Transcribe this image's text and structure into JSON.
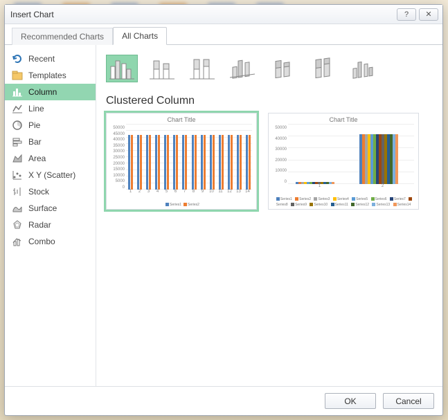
{
  "window": {
    "title": "Insert Chart",
    "help_glyph": "?",
    "close_glyph": "✕"
  },
  "tabs": {
    "recommended": "Recommended Charts",
    "all": "All Charts",
    "active": "all"
  },
  "sidebar": {
    "items": [
      {
        "id": "recent",
        "label": "Recent"
      },
      {
        "id": "templates",
        "label": "Templates"
      },
      {
        "id": "column",
        "label": "Column"
      },
      {
        "id": "line",
        "label": "Line"
      },
      {
        "id": "pie",
        "label": "Pie"
      },
      {
        "id": "bar",
        "label": "Bar"
      },
      {
        "id": "area",
        "label": "Area"
      },
      {
        "id": "xy",
        "label": "X Y (Scatter)"
      },
      {
        "id": "stock",
        "label": "Stock"
      },
      {
        "id": "surface",
        "label": "Surface"
      },
      {
        "id": "radar",
        "label": "Radar"
      },
      {
        "id": "combo",
        "label": "Combo"
      }
    ],
    "selected": "column"
  },
  "section": {
    "title": "Clustered Column"
  },
  "subtypes": {
    "selected": 0,
    "count": 7
  },
  "previews": {
    "p1": {
      "title": "Chart Title",
      "legend": [
        "Series1",
        "Series2"
      ]
    },
    "p2": {
      "title": "Chart Title",
      "legend": [
        "Series1",
        "Series2",
        "Series3",
        "Series4",
        "Series5",
        "Series6",
        "Series7",
        "Series8",
        "Series9",
        "Series10",
        "Series11",
        "Series12",
        "Series13",
        "Series14"
      ]
    }
  },
  "buttons": {
    "ok": "OK",
    "cancel": "Cancel"
  },
  "chart_data": [
    {
      "type": "bar",
      "title": "Chart Title",
      "categories": [
        "1",
        "2",
        "3",
        "4",
        "5",
        "6",
        "7",
        "8",
        "9",
        "10",
        "11",
        "12",
        "13",
        "14"
      ],
      "series": [
        {
          "name": "Series1",
          "values": [
            42000,
            42000,
            42000,
            42000,
            42000,
            42000,
            42000,
            42000,
            42000,
            42000,
            42000,
            42000,
            42000,
            42000
          ]
        },
        {
          "name": "Series2",
          "values": [
            42000,
            42000,
            42000,
            42000,
            42000,
            42000,
            42000,
            42000,
            42000,
            42000,
            42000,
            42000,
            42000,
            42000
          ]
        }
      ],
      "ylim": [
        0,
        50000
      ],
      "yticks": [
        0,
        5000,
        10000,
        15000,
        20000,
        25000,
        30000,
        35000,
        40000,
        45000,
        50000
      ],
      "colors": [
        "#4e81bd",
        "#ed7d31"
      ]
    },
    {
      "type": "bar",
      "title": "Chart Title",
      "categories": [
        "1",
        "2"
      ],
      "series": [
        {
          "name": "Series1",
          "values": [
            1500,
            42000
          ]
        },
        {
          "name": "Series2",
          "values": [
            1500,
            42000
          ]
        },
        {
          "name": "Series3",
          "values": [
            1500,
            42000
          ]
        },
        {
          "name": "Series4",
          "values": [
            1500,
            42000
          ]
        },
        {
          "name": "Series5",
          "values": [
            1500,
            42000
          ]
        },
        {
          "name": "Series6",
          "values": [
            1500,
            42000
          ]
        },
        {
          "name": "Series7",
          "values": [
            1500,
            42000
          ]
        },
        {
          "name": "Series8",
          "values": [
            1500,
            42000
          ]
        },
        {
          "name": "Series9",
          "values": [
            1500,
            42000
          ]
        },
        {
          "name": "Series10",
          "values": [
            1500,
            42000
          ]
        },
        {
          "name": "Series11",
          "values": [
            1500,
            42000
          ]
        },
        {
          "name": "Series12",
          "values": [
            1500,
            42000
          ]
        },
        {
          "name": "Series13",
          "values": [
            1500,
            42000
          ]
        },
        {
          "name": "Series14",
          "values": [
            1500,
            42000
          ]
        }
      ],
      "ylim": [
        0,
        50000
      ],
      "yticks": [
        0,
        10000,
        20000,
        30000,
        40000,
        50000
      ],
      "colors": [
        "#4e81bd",
        "#ed7d31",
        "#a5a5a5",
        "#ffc000",
        "#5b9bd5",
        "#70ad47",
        "#264478",
        "#9e480e",
        "#636363",
        "#997300",
        "#255e91",
        "#43682b",
        "#7cafdd",
        "#f1975a"
      ]
    }
  ]
}
